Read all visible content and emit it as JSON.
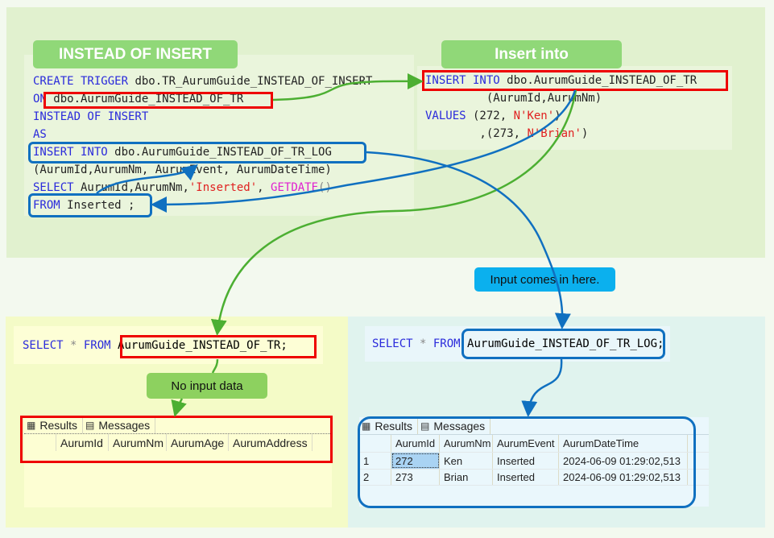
{
  "labels": {
    "instead_of_insert": "INSTEAD OF INSERT",
    "insert_into": "Insert into",
    "no_input_data": "No input data",
    "input_comes_in_here": "Input comes in here."
  },
  "trigger_code": {
    "line1": {
      "kw": "CREATE TRIGGER",
      "rest": " dbo.TR_AurumGuide_INSTEAD_OF_INSERT"
    },
    "line2": {
      "kw": "ON",
      "rest": " dbo.AurumGuide_INSTEAD_OF_TR"
    },
    "line3": {
      "kw": "INSTEAD OF INSERT"
    },
    "line4": {
      "kw": "AS"
    },
    "line5": {
      "kw": "INSERT INTO",
      "rest": " dbo.AurumGuide_INSTEAD_OF_TR_LOG"
    },
    "line6": {
      "text": "(AurumId,AurumNm, AurumEvent, AurumDateTime)"
    },
    "line7": {
      "kw": "SELECT",
      "rest": " AurumId,AurumNm,",
      "str": "'Inserted'",
      "comma": ", ",
      "fn": "GETDATE",
      "paren": "()"
    },
    "line8": {
      "kw": "FROM",
      "rest": " Inserted ;"
    }
  },
  "insert_code": {
    "line1": {
      "kw": "INSERT INTO",
      "rest": " dbo.AurumGuide_INSTEAD_OF_TR"
    },
    "line2": {
      "text": "         (AurumId,AurumNm)"
    },
    "line3": {
      "kw": "VALUES",
      "rest": " (272, ",
      "str": "N'Ken'",
      "end": ")"
    },
    "line4": {
      "pre": "        ,(273, ",
      "str": "N'Brian'",
      "end": ")"
    }
  },
  "select_left": {
    "kw1": "SELECT",
    "star": " * ",
    "kw2": "FROM",
    "table": "AurumGuide_INSTEAD_OF_TR;"
  },
  "select_right": {
    "kw1": "SELECT",
    "star": " * ",
    "kw2": "FROM",
    "table": "AurumGuide_INSTEAD_OF_TR_LOG;"
  },
  "results_left": {
    "tabs": [
      "Results",
      "Messages"
    ],
    "columns": [
      "AurumId",
      "AurumNm",
      "AurumAge",
      "AurumAddress"
    ],
    "rows": []
  },
  "results_right": {
    "tabs": [
      "Results",
      "Messages"
    ],
    "columns": [
      "AurumId",
      "AurumNm",
      "AurumEvent",
      "AurumDateTime"
    ],
    "rows": [
      {
        "n": "1",
        "id": "272",
        "nm": "Ken",
        "event": "Inserted",
        "dt": "2024-06-09 01:29:02,513"
      },
      {
        "n": "2",
        "id": "273",
        "nm": "Brian",
        "event": "Inserted",
        "dt": "2024-06-09 01:29:02,513"
      }
    ]
  },
  "colors": {
    "green_arrow": "#4caf32",
    "blue_arrow": "#1070c0",
    "red_box": "#ee0000"
  }
}
